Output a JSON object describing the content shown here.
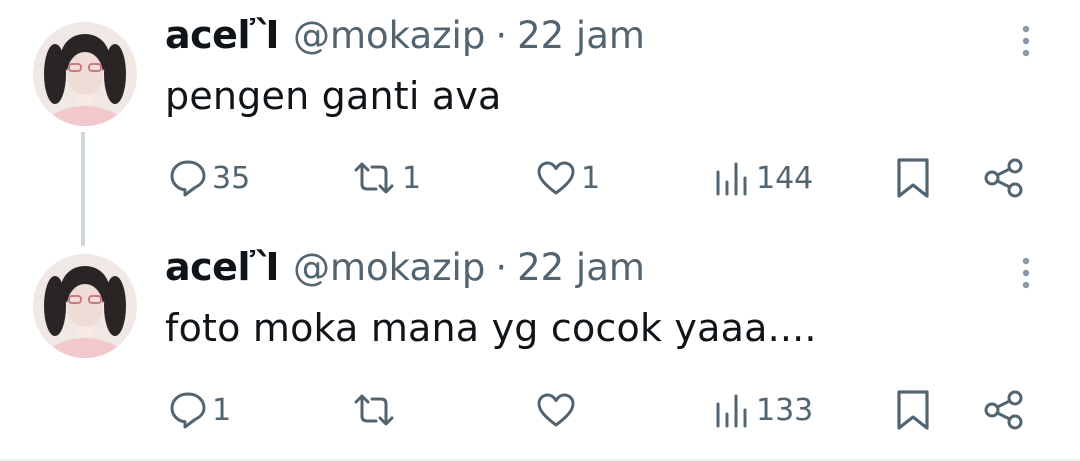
{
  "tweets": [
    {
      "display_name": "acelἺ",
      "handle": "@mokazip",
      "separator": "·",
      "time": "22 jam",
      "text": "pengen ganti ava",
      "replies": "35",
      "retweets": "1",
      "likes": "1",
      "views": "144"
    },
    {
      "display_name": "acelἺ",
      "handle": "@mokazip",
      "separator": "·",
      "time": "22 jam",
      "text": "foto moka mana yg cocok yaaa....",
      "replies": "1",
      "retweets": "",
      "likes": "",
      "views": "133"
    }
  ],
  "icons": {
    "more": "more-vertical-icon",
    "reply": "reply-bubble-icon",
    "retweet": "retweet-icon",
    "like": "heart-icon",
    "views": "views-bar-chart-icon",
    "bookmark": "bookmark-icon",
    "share": "share-icon"
  },
  "colors": {
    "text_primary": "#0f1419",
    "text_secondary": "#536471",
    "thread_line": "#cfd9de",
    "background": "#ffffff"
  }
}
